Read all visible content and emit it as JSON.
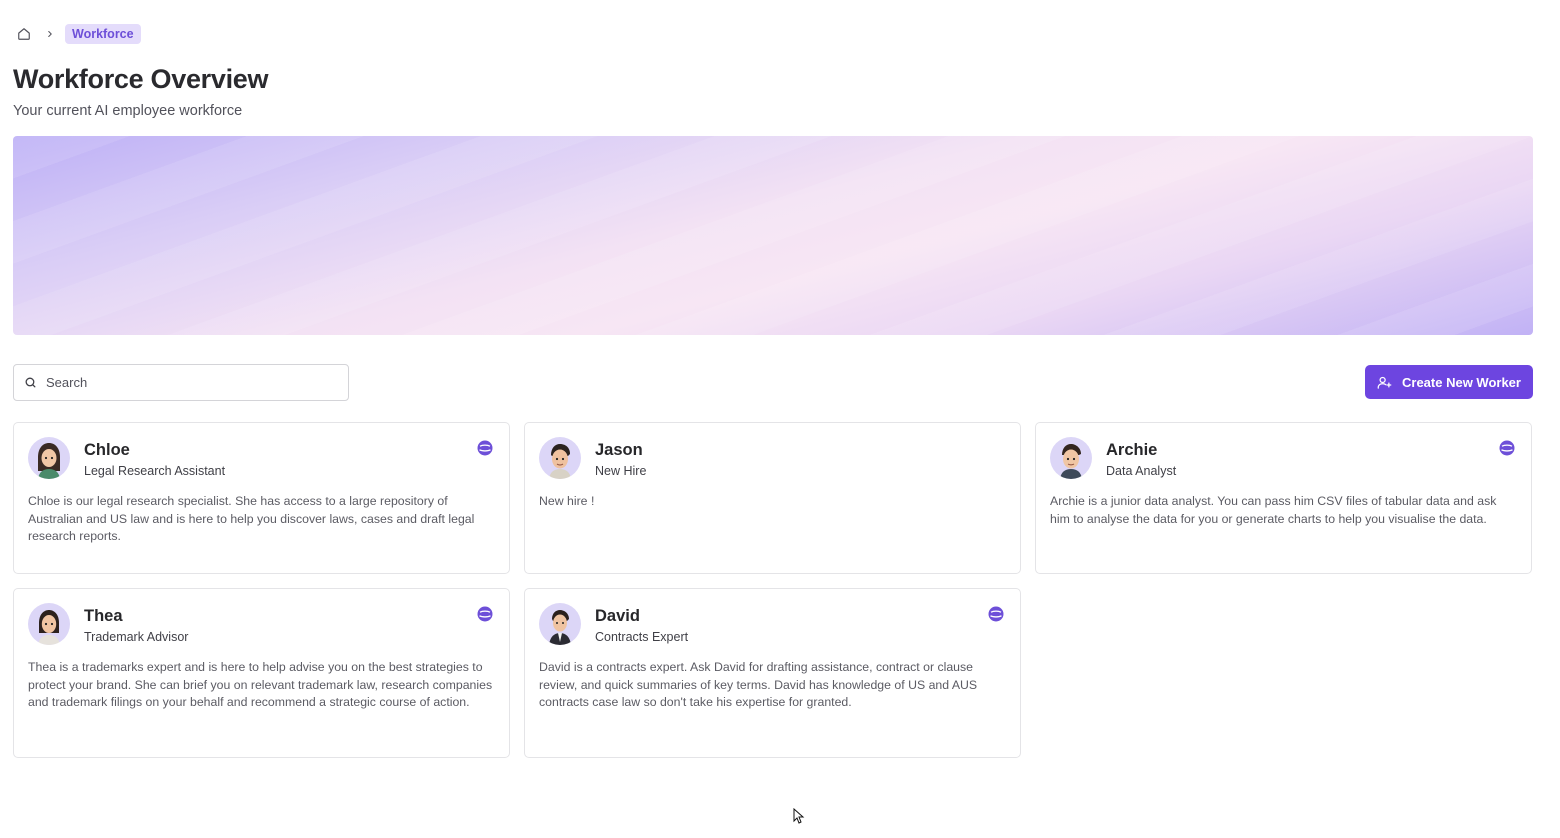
{
  "breadcrumb": {
    "current": "Workforce"
  },
  "header": {
    "title": "Workforce Overview",
    "subtitle": "Your current AI employee workforce"
  },
  "search": {
    "placeholder": "Search",
    "value": ""
  },
  "actions": {
    "create_label": "Create New Worker"
  },
  "colors": {
    "accent": "#6d45e0",
    "badge": "#6d4fd8",
    "breadcrumb_bg": "#e4dcfb"
  },
  "workers": [
    {
      "name": "Chloe",
      "role": "Legal Research Assistant",
      "badge": true,
      "description": "Chloe is our legal research specialist. She has access to a large repository of Australian and US law and is here to help you discover laws, cases and draft legal research reports."
    },
    {
      "name": "Jason",
      "role": "New Hire",
      "badge": false,
      "description": "New hire !"
    },
    {
      "name": "Archie",
      "role": "Data Analyst",
      "badge": true,
      "description": "Archie is a junior data analyst. You can pass him CSV files of tabular data and ask him to analyse the data for you or generate charts to help you visualise the data."
    },
    {
      "name": "Thea",
      "role": "Trademark Advisor",
      "badge": true,
      "description": "Thea is a trademarks expert and is here to help advise you on the best strategies to protect your brand. She can brief you on relevant trademark law, research companies and trademark filings on your behalf and recommend a strategic course of action."
    },
    {
      "name": "David",
      "role": "Contracts Expert",
      "badge": true,
      "description": "David is a contracts expert. Ask David for drafting assistance, contract or clause review, and quick summaries of key terms. David has knowledge of US and AUS contracts case law so don't take his expertise for granted."
    }
  ]
}
